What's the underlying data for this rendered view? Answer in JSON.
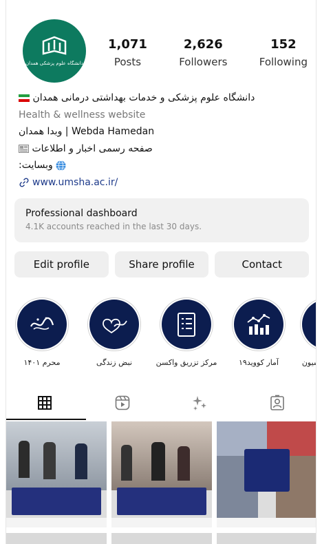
{
  "profile": {
    "avatar_text": "دانشگاه علوم پزشکی همدان",
    "stats": [
      {
        "value": "1,071",
        "label": "Posts"
      },
      {
        "value": "2,626",
        "label": "Followers"
      },
      {
        "value": "152",
        "label": "Following"
      }
    ],
    "bio": {
      "name": "دانشگاه علوم پزشکی و خدمات بهداشتی درمانی همدان",
      "category": "Health & wellness website",
      "line2": "وبدا همدان | Webda Hamedan",
      "line3": "صفحه رسمی اخبار و اطلاعات",
      "line4": ":وبسایت",
      "link": "www.umsha.ac.ir/"
    }
  },
  "dashboard": {
    "title": "Professional dashboard",
    "subtitle": "4.1K accounts reached in the last 30 days."
  },
  "buttons": {
    "edit": "Edit profile",
    "share": "Share profile",
    "contact": "Contact"
  },
  "highlights": [
    {
      "label": "محرم ۱۴۰۱",
      "icon": "calligraphy-icon"
    },
    {
      "label": "نبض زندگی",
      "icon": "heartbeat-icon"
    },
    {
      "label": "مرکز تزریق واکسن",
      "icon": "clipboard-icon"
    },
    {
      "label": "آمار کووید۱۹",
      "icon": "chart-icon"
    },
    {
      "label": "سیون",
      "icon": "partial-icon"
    }
  ],
  "colors": {
    "avatar_bg": "#0d7a5f",
    "highlight_bg": "#0c1d4f",
    "link": "#1d3a8a",
    "post_band": "#24307d"
  }
}
